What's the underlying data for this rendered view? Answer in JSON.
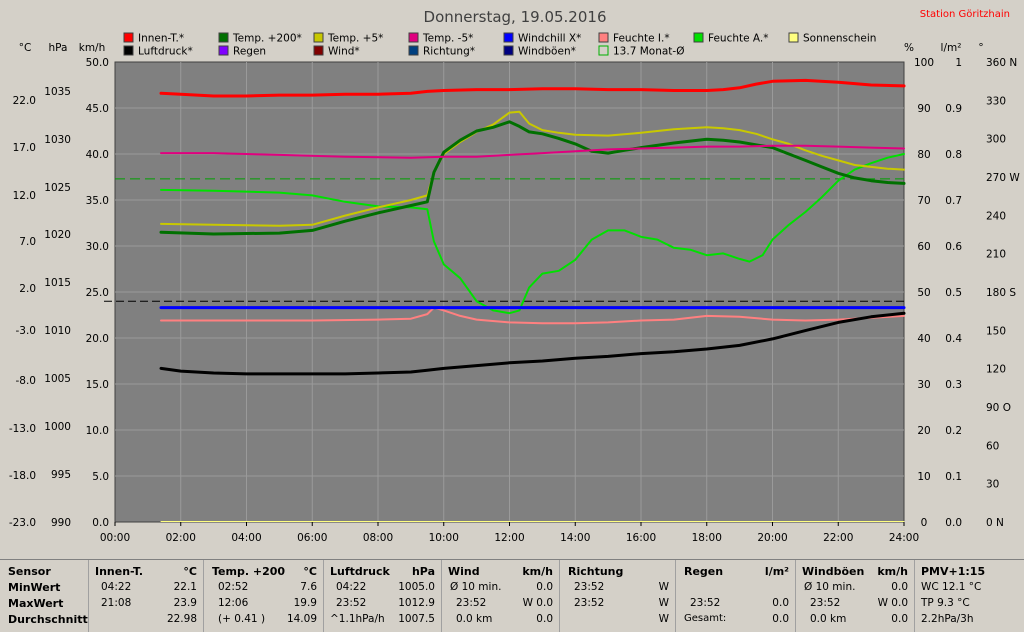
{
  "title": "Donnerstag, 19.05.2016",
  "station": "Station Göritzhain",
  "colors": {
    "plot_bg": "#808080",
    "grid": "#9a9a9a",
    "innen_t": "#ff0000",
    "temp200": "#007000",
    "temp5": "#c8c800",
    "temp_minus5": "#e0007f",
    "windchill": "#0000ff",
    "feuchte_i": "#ff8080",
    "feuchte_a": "#00e000",
    "sonnenschein": "#ffff80",
    "luftdruck": "#000000",
    "regen": "#8000ff",
    "wind": "#800000",
    "richtung": "#004080",
    "windboeen": "#000080",
    "monat_line": "#00b000"
  },
  "legend": [
    {
      "label": "Innen-T.*",
      "color": "#ff0000"
    },
    {
      "label": "Temp. +200*",
      "color": "#007000"
    },
    {
      "label": "Temp. +5*",
      "color": "#c8c800"
    },
    {
      "label": "Temp. -5*",
      "color": "#e0007f"
    },
    {
      "label": "Windchill X*",
      "color": "#0000ff"
    },
    {
      "label": "Feuchte I.*",
      "color": "#ff8080"
    },
    {
      "label": "Feuchte A.*",
      "color": "#00e000"
    },
    {
      "label": "Sonnenschein",
      "color": "#ffff80"
    },
    {
      "label": "Luftdruck*",
      "color": "#000000"
    },
    {
      "label": "Regen",
      "color": "#8000ff"
    },
    {
      "label": "Wind*",
      "color": "#800000"
    },
    {
      "label": "Richtung*",
      "color": "#004080"
    },
    {
      "label": "Windböen*",
      "color": "#000080"
    },
    {
      "label": "13.7 Monat-Ø",
      "color": "#00b000",
      "outline": true
    }
  ],
  "axis_units": {
    "c": "°C",
    "hpa": "hPa",
    "kmh": "km/h",
    "pct": "%",
    "lm2": "l/m²",
    "deg": "°"
  },
  "chart_data": {
    "type": "line",
    "x_ticks": [
      "00:00",
      "02:00",
      "04:00",
      "06:00",
      "08:00",
      "10:00",
      "12:00",
      "14:00",
      "16:00",
      "18:00",
      "20:00",
      "22:00",
      "24:00"
    ],
    "xlim_hours": [
      0,
      24
    ],
    "axes": {
      "temp_c": {
        "ticks": [
          "22.0",
          "17.0",
          "12.0",
          "7.0",
          "2.0",
          "-3.0",
          "-8.0",
          "-13.0",
          "-18.0",
          "-23.0"
        ]
      },
      "pressure_hpa": {
        "ticks": [
          "1035",
          "1030",
          "1025",
          "1020",
          "1015",
          "1010",
          "1005",
          "1000",
          "995",
          "990"
        ]
      },
      "wind_kmh": {
        "ticks": [
          "50.0",
          "45.0",
          "40.0",
          "35.0",
          "30.0",
          "25.0",
          "20.0",
          "15.0",
          "10.0",
          "5.0",
          "0.0"
        ],
        "ylim": [
          0,
          50
        ]
      },
      "humidity_pct": {
        "ticks": [
          "100",
          "90",
          "80",
          "70",
          "60",
          "50",
          "40",
          "30",
          "20",
          "10",
          "0"
        ],
        "ylim": [
          0,
          100
        ]
      },
      "rain_lm2": {
        "ticks": [
          "1",
          "0.9",
          "0.8",
          "0.7",
          "0.6",
          "0.5",
          "0.4",
          "0.3",
          "0.2",
          "0.1",
          "0.0"
        ],
        "ylim": [
          0,
          1
        ]
      },
      "direction_deg": {
        "ticks": [
          "360 N",
          "330",
          "300",
          "270 W",
          "240",
          "210",
          "180 S",
          "150",
          "120",
          "90 O",
          "60",
          "30",
          "0 N"
        ],
        "ylim": [
          0,
          360
        ]
      }
    },
    "series_scale_note": "values below given in km/h-axis units (0–50)",
    "series": [
      {
        "name": "Innen-T.*",
        "color": "#ff0000",
        "width": 3,
        "x": [
          1.4,
          2,
          3,
          4,
          5,
          6,
          7,
          8,
          9,
          9.5,
          10,
          11,
          12,
          13,
          14,
          15,
          16,
          17,
          18,
          18.5,
          19,
          19.5,
          20,
          21,
          22,
          23,
          24
        ],
        "y": [
          46.6,
          46.5,
          46.3,
          46.3,
          46.4,
          46.4,
          46.5,
          46.5,
          46.6,
          46.8,
          46.9,
          47.0,
          47.0,
          47.1,
          47.1,
          47.0,
          47.0,
          46.9,
          46.9,
          47.0,
          47.2,
          47.6,
          47.9,
          48.0,
          47.8,
          47.5,
          47.4
        ]
      },
      {
        "name": "Feuchte A.*",
        "color": "#00e000",
        "width": 2,
        "x": [
          1.4,
          3,
          5,
          6,
          7,
          8,
          9,
          9.5,
          9.7,
          10,
          10.5,
          11,
          11.5,
          12,
          12.3,
          12.6,
          13,
          13.5,
          14,
          14.5,
          15,
          15.5,
          16,
          16.5,
          17,
          17.5,
          18,
          18.5,
          19,
          19.3,
          19.7,
          20,
          20.5,
          21,
          21.5,
          22,
          22.5,
          23,
          23.5,
          24
        ],
        "y": [
          36.1,
          36.0,
          35.8,
          35.5,
          34.8,
          34.3,
          34.2,
          34.0,
          30.5,
          28.0,
          26.5,
          24.0,
          23.0,
          22.7,
          23.0,
          25.5,
          27.0,
          27.3,
          28.5,
          30.7,
          31.7,
          31.7,
          31.0,
          30.7,
          29.8,
          29.6,
          29.0,
          29.2,
          28.6,
          28.3,
          29.0,
          30.7,
          32.3,
          33.7,
          35.3,
          37.1,
          38.3,
          39.0,
          39.6,
          40.0
        ]
      },
      {
        "name": "Temp. +5*",
        "color": "#c8c800",
        "width": 2,
        "x": [
          1.4,
          3,
          5,
          6,
          7,
          8,
          9,
          9.5,
          9.7,
          10,
          10.5,
          11,
          11.5,
          12,
          12.3,
          12.6,
          13,
          13.5,
          14,
          15,
          16,
          17,
          18,
          18.5,
          19,
          19.5,
          20,
          20.5,
          21,
          21.5,
          22,
          22.5,
          23,
          23.5,
          24
        ],
        "y": [
          32.4,
          32.3,
          32.2,
          32.3,
          33.3,
          34.2,
          35.0,
          35.5,
          38.0,
          40.0,
          41.3,
          42.4,
          43.2,
          44.5,
          44.6,
          43.3,
          42.6,
          42.3,
          42.1,
          42.0,
          42.3,
          42.7,
          42.9,
          42.8,
          42.6,
          42.2,
          41.6,
          41.1,
          40.4,
          39.8,
          39.3,
          38.8,
          38.6,
          38.4,
          38.3
        ]
      },
      {
        "name": "Temp. +200*",
        "color": "#007000",
        "width": 3,
        "x": [
          1.4,
          3,
          5,
          6,
          7,
          8,
          9,
          9.5,
          9.7,
          10,
          10.5,
          11,
          11.5,
          12,
          12.3,
          12.6,
          13,
          13.5,
          14,
          14.5,
          15,
          15.5,
          16,
          17,
          18,
          18.5,
          19,
          19.5,
          20,
          20.5,
          21,
          21.5,
          22,
          22.5,
          23,
          23.5,
          24
        ],
        "y": [
          31.5,
          31.3,
          31.4,
          31.7,
          32.7,
          33.6,
          34.4,
          34.8,
          38.0,
          40.2,
          41.5,
          42.5,
          42.9,
          43.5,
          43.0,
          42.4,
          42.2,
          41.7,
          41.1,
          40.3,
          40.1,
          40.4,
          40.7,
          41.2,
          41.6,
          41.5,
          41.3,
          41.0,
          40.7,
          40.0,
          39.3,
          38.6,
          37.9,
          37.4,
          37.1,
          36.9,
          36.8
        ]
      },
      {
        "name": "Temp. -5*",
        "color": "#e0007f",
        "width": 2,
        "x": [
          1.4,
          3,
          5,
          7,
          9,
          10,
          11,
          12,
          13,
          14,
          15,
          16,
          17,
          18,
          19,
          20,
          21,
          22,
          23,
          24
        ],
        "y": [
          40.1,
          40.1,
          39.9,
          39.7,
          39.6,
          39.7,
          39.7,
          39.9,
          40.1,
          40.3,
          40.5,
          40.6,
          40.7,
          40.8,
          40.8,
          40.9,
          40.9,
          40.8,
          40.7,
          40.6
        ]
      },
      {
        "name": "Feuchte I.*",
        "color": "#ff8080",
        "width": 2,
        "x": [
          1.4,
          4,
          6,
          8,
          9,
          9.5,
          9.7,
          10,
          10.5,
          11,
          12,
          13,
          14,
          15,
          16,
          17,
          18,
          19,
          20,
          21,
          22,
          23,
          24
        ],
        "y": [
          21.9,
          21.9,
          21.9,
          22.0,
          22.1,
          22.6,
          23.3,
          23.0,
          22.4,
          22.0,
          21.7,
          21.6,
          21.6,
          21.7,
          21.9,
          22.0,
          22.4,
          22.3,
          22.0,
          21.9,
          22.0,
          22.2,
          22.4
        ]
      },
      {
        "name": "Windchill X*",
        "color": "#0000ff",
        "width": 3,
        "x": [
          1.4,
          24
        ],
        "y": [
          23.3,
          23.3
        ]
      },
      {
        "name": "Luftdruck*",
        "color": "#000000",
        "width": 3,
        "x": [
          1.4,
          2,
          3,
          4,
          5,
          6,
          7,
          8,
          9,
          9.5,
          10,
          11,
          12,
          13,
          14,
          15,
          16,
          17,
          18,
          19,
          20,
          21,
          22,
          23,
          24
        ],
        "y": [
          16.7,
          16.4,
          16.2,
          16.1,
          16.1,
          16.1,
          16.1,
          16.2,
          16.3,
          16.5,
          16.7,
          17.0,
          17.3,
          17.5,
          17.8,
          18.0,
          18.3,
          18.5,
          18.8,
          19.2,
          19.9,
          20.8,
          21.7,
          22.3,
          22.7
        ]
      },
      {
        "name": "Sonnenschein",
        "color": "#ffff80",
        "width": 1,
        "x": [
          1.4,
          24
        ],
        "y": [
          0.05,
          0.05
        ]
      }
    ],
    "ref_lines": [
      {
        "name": "13.7 Monat-Ø",
        "color": "#00a000",
        "y": 37.3,
        "dash": true
      },
      {
        "name": "pressure-ref",
        "color": "#000000",
        "y": 24.0,
        "dash": true
      }
    ]
  },
  "footer": {
    "sensor": {
      "h": "Sensor",
      "r1": "MinWert",
      "r2": "MaxWert",
      "r3": "Durchschnitt"
    },
    "innen": {
      "h": "Innen-T.",
      "u": "°C",
      "r1a": "04:22",
      "r1b": "22.1",
      "r2a": "21:08",
      "r2b": "23.9",
      "r3b": "22.98"
    },
    "temp200": {
      "h": "Temp. +200",
      "u": "°C",
      "r1a": "02:52",
      "r1b": "7.6",
      "r2a": "12:06",
      "r2b": "19.9",
      "r3a": "(+ 0.41 )",
      "r3b": "14.09"
    },
    "luftdruck": {
      "h": "Luftdruck",
      "u": "hPa",
      "r1a": "04:22",
      "r1b": "1005.0",
      "r2a": "23:52",
      "r2b": "1012.9",
      "r3a": "^1.1hPa/h",
      "r3b": "1007.5"
    },
    "wind": {
      "h": "Wind",
      "u": "km/h",
      "r1a": "Ø 10 min.",
      "r1b": "0.0",
      "r2a": "23:52",
      "r2b": "W 0.0",
      "r3a": "0.0 km",
      "r3b": "0.0"
    },
    "richtung": {
      "h": "Richtung",
      "r1a": "23:52",
      "r1b": "W",
      "r2a": "23:52",
      "r2b": "W",
      "r3b": "W"
    },
    "regen": {
      "h": "Regen",
      "u": "l/m²",
      "r2a": "23:52",
      "r2b": "0.0",
      "r3a": "Gesamt:",
      "r3b": "0.0"
    },
    "windboeen": {
      "h": "Windböen",
      "u": "km/h",
      "r1a": "Ø 10 min.",
      "r1b": "0.0",
      "r2a": "23:52",
      "r2b": "W 0.0",
      "r3a": "0.0 km",
      "r3b": "0.0"
    },
    "pmv": {
      "h": "PMV+1:15",
      "r1": "WC 12.1 °C",
      "r2": "TP 9.3 °C",
      "r3": "2.2hPa/3h"
    }
  }
}
